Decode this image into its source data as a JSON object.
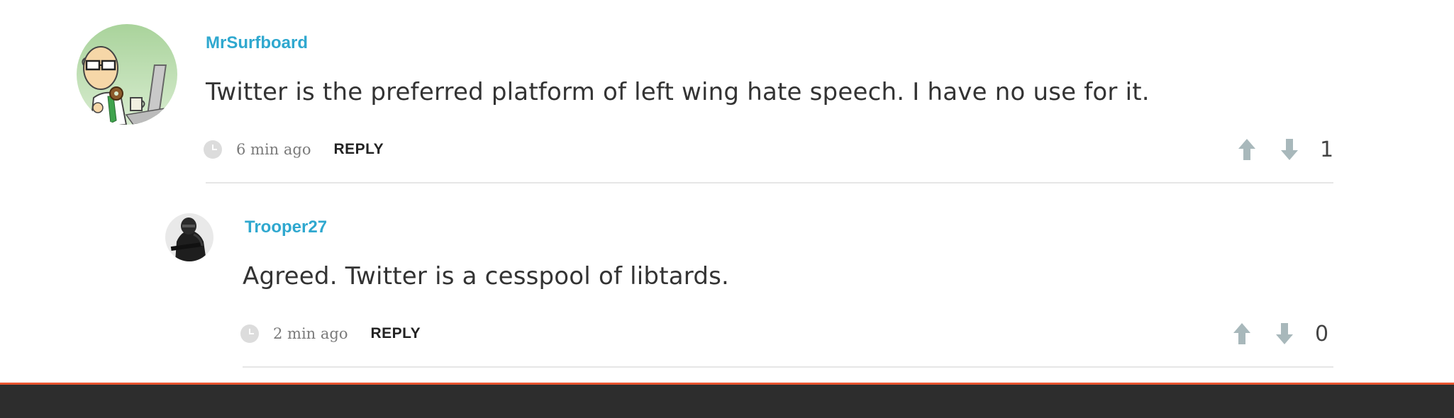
{
  "comments": [
    {
      "username": "MrSurfboard",
      "avatar_icon": "cartoon-office-worker-avatar",
      "body": "Twitter is the preferred platform of left wing hate speech. I have no use for it.",
      "timestamp": "6 min ago",
      "reply_label": "REPLY",
      "score": "1"
    },
    {
      "username": "Trooper27",
      "avatar_icon": "armored-soldier-avatar",
      "body": "Agreed. Twitter is a cesspool of libtards.",
      "timestamp": "2 min ago",
      "reply_label": "REPLY",
      "score": "0"
    }
  ],
  "colors": {
    "username": "#2fa8cf",
    "vote_arrow": "#a8b8bb",
    "footer": "#2d2d2d",
    "footer_accent": "#e8542f"
  }
}
